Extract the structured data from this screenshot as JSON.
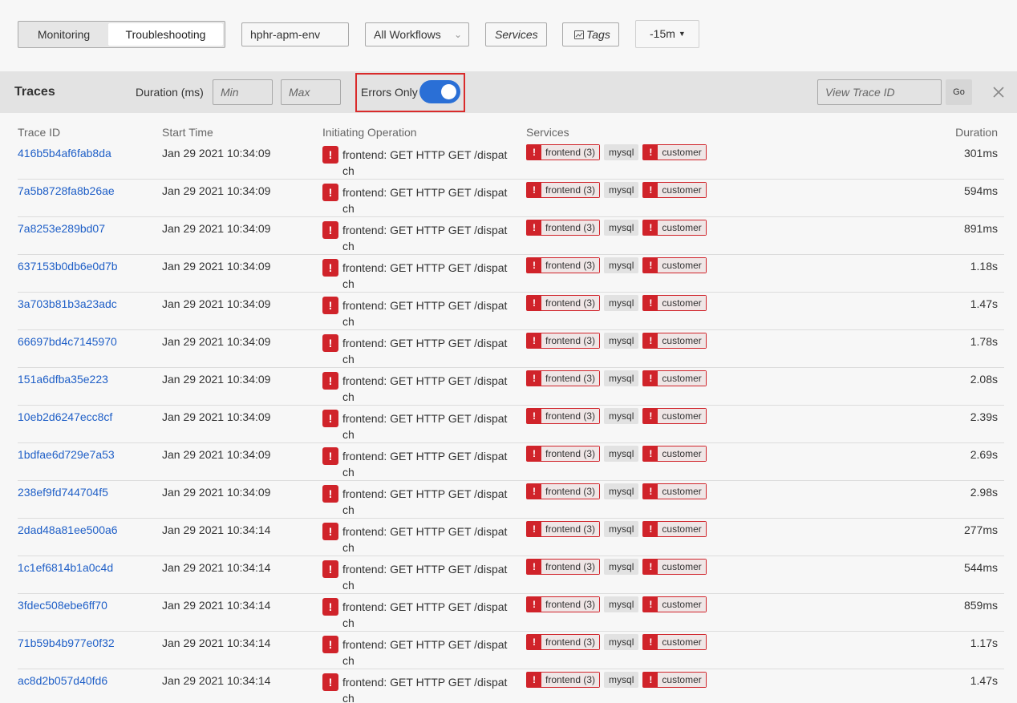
{
  "toolbar": {
    "tab_monitoring": "Monitoring",
    "tab_troubleshooting": "Troubleshooting",
    "environment": "hphr-apm-env",
    "workflows": "All Workflows",
    "services": "Services",
    "tags": "Tags",
    "time_range": "-15m"
  },
  "filterbar": {
    "title": "Traces",
    "duration_label": "Duration (ms)",
    "min_placeholder": "Min",
    "max_placeholder": "Max",
    "errors_only_label": "Errors Only",
    "errors_only_enabled": true,
    "trace_id_placeholder": "View Trace ID",
    "go_label": "Go"
  },
  "table": {
    "columns": {
      "trace_id": "Trace ID",
      "start_time": "Start Time",
      "operation": "Initiating Operation",
      "services": "Services",
      "duration": "Duration"
    },
    "rows": [
      {
        "id": "416b5b4af6fab8da",
        "start": "Jan 29 2021 10:34:09",
        "op": "frontend: GET HTTP GET /dispatch",
        "svc1": "frontend (3)",
        "svc2": "mysql",
        "svc3": "customer",
        "dur": "301ms"
      },
      {
        "id": "7a5b8728fa8b26ae",
        "start": "Jan 29 2021 10:34:09",
        "op": "frontend: GET HTTP GET /dispatch",
        "svc1": "frontend (3)",
        "svc2": "mysql",
        "svc3": "customer",
        "dur": "594ms"
      },
      {
        "id": "7a8253e289bd07",
        "start": "Jan 29 2021 10:34:09",
        "op": "frontend: GET HTTP GET /dispatch",
        "svc1": "frontend (3)",
        "svc2": "mysql",
        "svc3": "customer",
        "dur": "891ms"
      },
      {
        "id": "637153b0db6e0d7b",
        "start": "Jan 29 2021 10:34:09",
        "op": "frontend: GET HTTP GET /dispatch",
        "svc1": "frontend (3)",
        "svc2": "mysql",
        "svc3": "customer",
        "dur": "1.18s"
      },
      {
        "id": "3a703b81b3a23adc",
        "start": "Jan 29 2021 10:34:09",
        "op": "frontend: GET HTTP GET /dispatch",
        "svc1": "frontend (3)",
        "svc2": "mysql",
        "svc3": "customer",
        "dur": "1.47s"
      },
      {
        "id": "66697bd4c7145970",
        "start": "Jan 29 2021 10:34:09",
        "op": "frontend: GET HTTP GET /dispatch",
        "svc1": "frontend (3)",
        "svc2": "mysql",
        "svc3": "customer",
        "dur": "1.78s"
      },
      {
        "id": "151a6dfba35e223",
        "start": "Jan 29 2021 10:34:09",
        "op": "frontend: GET HTTP GET /dispatch",
        "svc1": "frontend (3)",
        "svc2": "mysql",
        "svc3": "customer",
        "dur": "2.08s"
      },
      {
        "id": "10eb2d6247ecc8cf",
        "start": "Jan 29 2021 10:34:09",
        "op": "frontend: GET HTTP GET /dispatch",
        "svc1": "frontend (3)",
        "svc2": "mysql",
        "svc3": "customer",
        "dur": "2.39s"
      },
      {
        "id": "1bdfae6d729e7a53",
        "start": "Jan 29 2021 10:34:09",
        "op": "frontend: GET HTTP GET /dispatch",
        "svc1": "frontend (3)",
        "svc2": "mysql",
        "svc3": "customer",
        "dur": "2.69s"
      },
      {
        "id": "238ef9fd744704f5",
        "start": "Jan 29 2021 10:34:09",
        "op": "frontend: GET HTTP GET /dispatch",
        "svc1": "frontend (3)",
        "svc2": "mysql",
        "svc3": "customer",
        "dur": "2.98s"
      },
      {
        "id": "2dad48a81ee500a6",
        "start": "Jan 29 2021 10:34:14",
        "op": "frontend: GET HTTP GET /dispatch",
        "svc1": "frontend (3)",
        "svc2": "mysql",
        "svc3": "customer",
        "dur": "277ms"
      },
      {
        "id": "1c1ef6814b1a0c4d",
        "start": "Jan 29 2021 10:34:14",
        "op": "frontend: GET HTTP GET /dispatch",
        "svc1": "frontend (3)",
        "svc2": "mysql",
        "svc3": "customer",
        "dur": "544ms"
      },
      {
        "id": "3fdec508ebe6ff70",
        "start": "Jan 29 2021 10:34:14",
        "op": "frontend: GET HTTP GET /dispatch",
        "svc1": "frontend (3)",
        "svc2": "mysql",
        "svc3": "customer",
        "dur": "859ms"
      },
      {
        "id": "71b59b4b977e0f32",
        "start": "Jan 29 2021 10:34:14",
        "op": "frontend: GET HTTP GET /dispatch",
        "svc1": "frontend (3)",
        "svc2": "mysql",
        "svc3": "customer",
        "dur": "1.17s"
      },
      {
        "id": "ac8d2b057d40fd6",
        "start": "Jan 29 2021 10:34:14",
        "op": "frontend: GET HTTP GET /dispatch",
        "svc1": "frontend (3)",
        "svc2": "mysql",
        "svc3": "customer",
        "dur": "1.47s"
      }
    ]
  },
  "colors": {
    "accent": "#2a6fd6",
    "link": "#1f5fc7",
    "error": "#d0232a",
    "highlight_border": "#d92b2b"
  },
  "icons": {
    "error": "exclamation-icon",
    "close": "close-icon",
    "tags": "chart-icon",
    "dropdown": "chevron-down-icon"
  }
}
